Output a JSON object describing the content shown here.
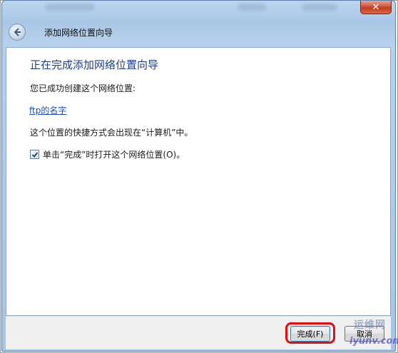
{
  "window": {
    "close_label": "✕"
  },
  "header": {
    "title": "添加网络位置向导"
  },
  "content": {
    "heading": "正在完成添加网络位置向导",
    "success_text": "您已成功创建这个网络位置:",
    "location_link": "ftp的名字",
    "shortcut_text": "这个位置的快捷方式会出现在“计算机”中。",
    "open_checkbox_label": "单击“完成”时打开这个网络位置(O)。",
    "open_checkbox_checked": true
  },
  "buttons": {
    "finish_label": "完成(F)",
    "cancel_label": "取消"
  },
  "watermark": {
    "site_cn": "运维网",
    "site_url": "iyunv.com"
  },
  "colors": {
    "heading": "#1e3d8a",
    "link": "#1f4fb8",
    "highlight": "#e01010"
  }
}
